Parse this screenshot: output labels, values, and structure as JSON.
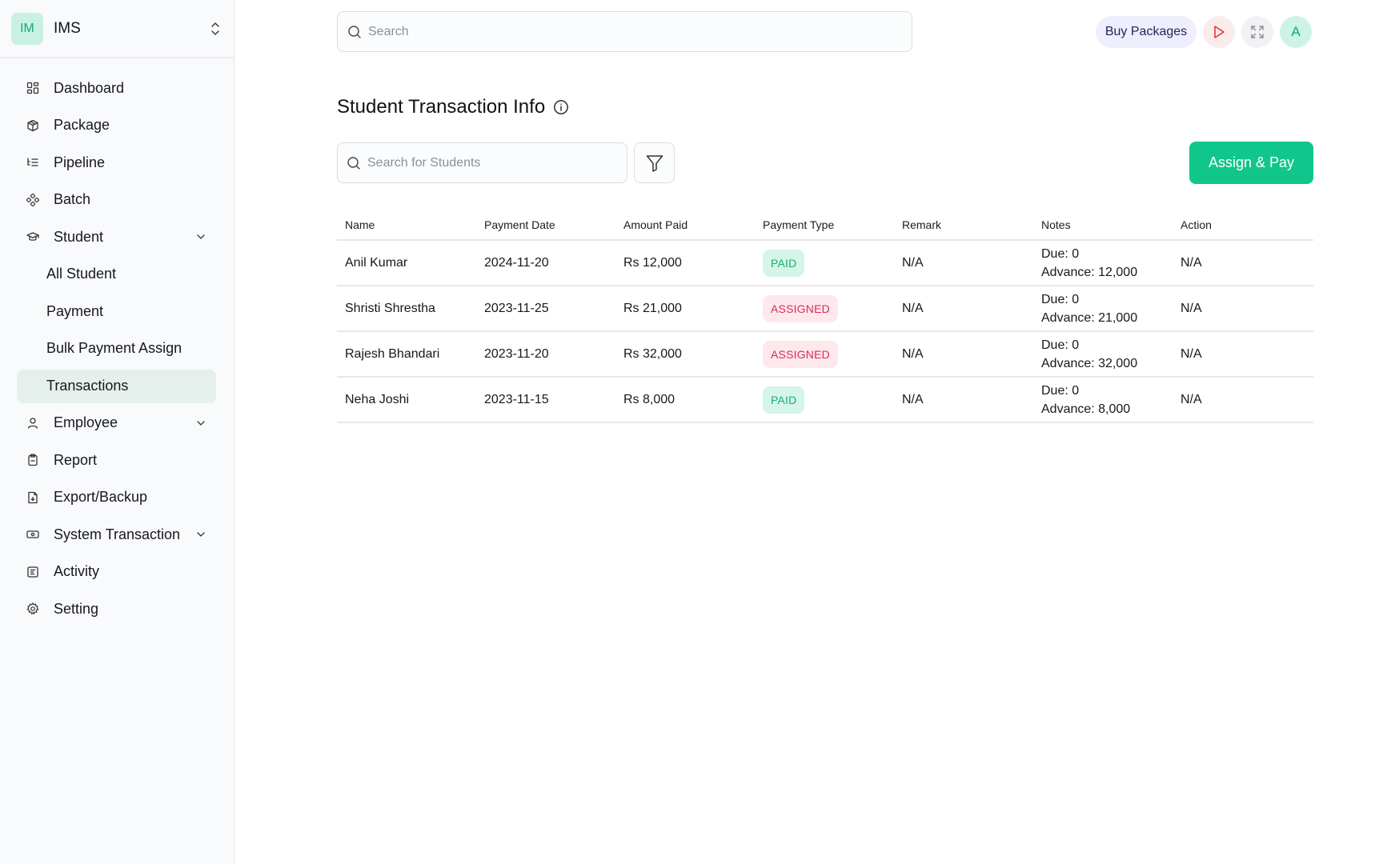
{
  "brand": {
    "logo_text": "IM",
    "name": "IMS"
  },
  "sidebar": {
    "items": [
      {
        "label": "Dashboard",
        "icon": "dashboard-icon"
      },
      {
        "label": "Package",
        "icon": "package-icon"
      },
      {
        "label": "Pipeline",
        "icon": "pipeline-icon"
      },
      {
        "label": "Batch",
        "icon": "batch-icon"
      },
      {
        "label": "Student",
        "icon": "graduation-cap-icon",
        "expanded": true,
        "children": [
          {
            "label": "All Student"
          },
          {
            "label": "Payment"
          },
          {
            "label": "Bulk Payment Assign"
          },
          {
            "label": "Transactions",
            "active": true
          }
        ]
      },
      {
        "label": "Employee",
        "icon": "user-icon",
        "expandable": true
      },
      {
        "label": "Report",
        "icon": "clipboard-icon"
      },
      {
        "label": "Export/Backup",
        "icon": "file-download-icon"
      },
      {
        "label": "System Transaction",
        "icon": "banknote-icon",
        "expandable": true
      },
      {
        "label": "Activity",
        "icon": "activity-log-icon"
      },
      {
        "label": "Setting",
        "icon": "gear-icon"
      }
    ]
  },
  "topbar": {
    "search_placeholder": "Search",
    "buy_packages_label": "Buy Packages",
    "avatar_initial": "A"
  },
  "page": {
    "title": "Student Transaction Info",
    "student_search_placeholder": "Search for Students",
    "assign_pay_label": "Assign & Pay"
  },
  "table": {
    "headers": [
      "Name",
      "Payment Date",
      "Amount Paid",
      "Payment Type",
      "Remark",
      "Notes",
      "Action"
    ],
    "rows": [
      {
        "name": "Anil Kumar",
        "date": "2024-11-20",
        "amount": "Rs 12,000",
        "type": "PAID",
        "remark": "N/A",
        "notes_due": "Due: 0",
        "notes_advance": "Advance: 12,000",
        "action": "N/A"
      },
      {
        "name": "Shristi Shrestha",
        "date": "2023-11-25",
        "amount": "Rs 21,000",
        "type": "ASSIGNED",
        "remark": "N/A",
        "notes_due": "Due: 0",
        "notes_advance": "Advance: 21,000",
        "action": "N/A"
      },
      {
        "name": "Rajesh Bhandari",
        "date": "2023-11-20",
        "amount": "Rs 32,000",
        "type": "ASSIGNED",
        "remark": "N/A",
        "notes_due": "Due: 0",
        "notes_advance": "Advance: 32,000",
        "action": "N/A"
      },
      {
        "name": "Neha Joshi",
        "date": "2023-11-15",
        "amount": "Rs 8,000",
        "type": "PAID",
        "remark": "N/A",
        "notes_due": "Due: 0",
        "notes_advance": "Advance: 8,000",
        "action": "N/A"
      }
    ]
  },
  "colors": {
    "accent": "#11c68a",
    "paid_bg": "#d4f5e8",
    "paid_text": "#17ad78",
    "assigned_bg": "#fde8ec",
    "assigned_text": "#d62a6a",
    "active_nav_bg": "#e5f0ec"
  }
}
